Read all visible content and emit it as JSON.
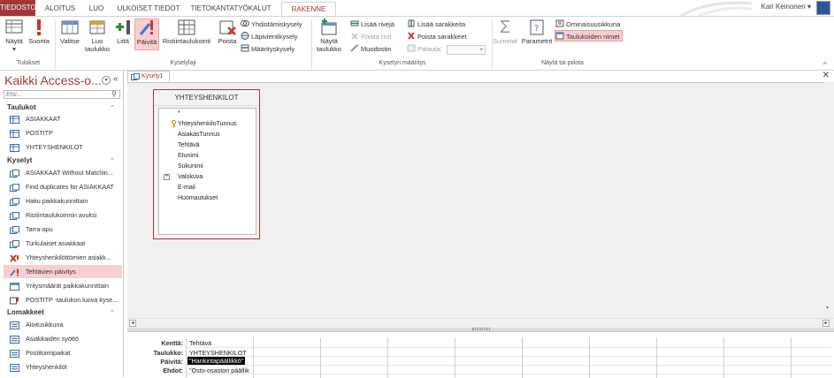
{
  "tabs": [
    {
      "label": "TIEDOSTO",
      "x": 0
    },
    {
      "label": "ALOITUS"
    },
    {
      "label": "LUO"
    },
    {
      "label": "ULKOISET TIEDOT"
    },
    {
      "label": "TIETOKANTATYÖKALUT"
    },
    {
      "label": "RAKENNE"
    }
  ],
  "user": {
    "name": "Kari Keinonen"
  },
  "ribbon": {
    "results": {
      "label": "Tulokset",
      "view": "Näytä",
      "run": "Suorita"
    },
    "query_type": {
      "label": "Kyselylaji",
      "select": "Valitse",
      "make_table": "Luo taulukko",
      "append": "Liitä",
      "update": "Päivitä",
      "crosstab": "Ristiintaulukointi",
      "delete": "Poista",
      "union": "Yhdistämiskysely",
      "passthrough": "Läpivientikysely",
      "data_def": "Määrityskysely"
    },
    "query_setup": {
      "label": "Kyselyn määritys",
      "show_table": "Näytä taulukko",
      "insert_rows": "Lisää rivejä",
      "delete_rows": "Poista rivit",
      "builder": "Muodostin",
      "insert_cols": "Lisää sarakkeita",
      "delete_cols": "Poista sarakkeet",
      "return": "Palauta:",
      "return_value": ""
    },
    "show_hide": {
      "label": "Näytä tai piilota",
      "totals": "Summat",
      "parameters": "Parametrit",
      "property_sheet": "Ominaisuusikkuna",
      "table_names": "Taulukoiden nimet"
    }
  },
  "nav": {
    "title": "Kaikki Access-o...",
    "search_placeholder": "Etsi...",
    "groups": [
      {
        "header": "Taulukot",
        "items": [
          "ASIAKKAAT",
          "POSTITP",
          "YHTEYSHENKILOT"
        ]
      },
      {
        "header": "Kyselyt",
        "items": [
          "ASIAKKAAT Without Matchin...",
          "Find duplicates for ASIAKKAAT",
          "Haku paikkakunnittain",
          "Ristiintaulukoinnin avuksi",
          "Tarra-apu",
          "Turkulaiset asiakkaat",
          "Yhteyshenkilöttömien asiakk...",
          "Tehtävien päivitys",
          "Yritysmäärät paikkakunnittain",
          "POSTITP -taulukon luova kyse..."
        ]
      },
      {
        "header": "Lomakkeet",
        "items": [
          "Aloitusikkuna",
          "Asiakkaiden syöttö",
          "Postitoimipaikat",
          "Yhteyshenkilöt"
        ]
      }
    ]
  },
  "document": {
    "tab_label": "Kysely1",
    "table": {
      "name": "YHTEYSHENKILOT",
      "fields": [
        "*",
        "YhteyshenkiloTunnus",
        "AsiakasTunnus",
        "Tehtävä",
        "Etunimi",
        "Sukunimi",
        "Valokuva",
        "E-mail",
        "Huomautukset"
      ]
    },
    "grid": {
      "labels": [
        "Kenttä:",
        "Taulukko:",
        "Päivitä:",
        "Ehdot:"
      ],
      "values": [
        "Tehtävä",
        "YHTEYSHENKILOT",
        "\"Hankintapäällikkö\"",
        "\"Osto-osaston päällik"
      ]
    }
  },
  "colors": {
    "accent": "#a4373a",
    "highlight": "#f8cfd0"
  }
}
